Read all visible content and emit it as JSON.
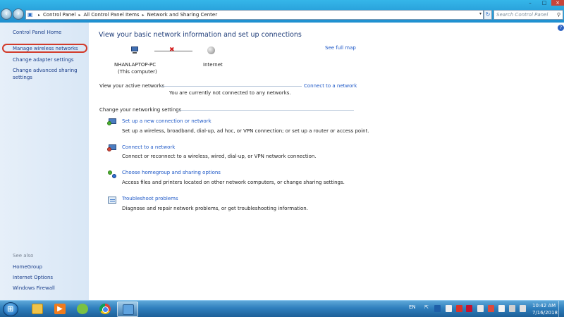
{
  "address": {
    "crumbs": [
      "Control Panel",
      "All Control Panel Items",
      "Network and Sharing Center"
    ],
    "separator": "▸",
    "search_placeholder": "Search Control Panel"
  },
  "window_controls": {
    "minimize": "–",
    "maximize": "□",
    "close": "×"
  },
  "sidebar": {
    "home": "Control Panel Home",
    "items": [
      {
        "label": "Manage wireless networks"
      },
      {
        "label": "Change adapter settings"
      },
      {
        "label": "Change advanced sharing"
      },
      {
        "label": "settings"
      }
    ],
    "see_also_heading": "See also",
    "see_also": [
      {
        "label": "HomeGroup"
      },
      {
        "label": "Internet Options"
      },
      {
        "label": "Windows Firewall"
      }
    ]
  },
  "main": {
    "title": "View your basic network information and set up connections",
    "see_full_map": "See full map",
    "computer_name": "NHANLAPTOP-PC",
    "computer_sub": "(This computer)",
    "internet_label": "Internet",
    "active_networks_label": "View your active networks",
    "connect_link": "Connect to a network",
    "not_connected": "You are currently not connected to any networks.",
    "change_settings_label": "Change your networking settings",
    "tasks": [
      {
        "title": "Set up a new connection or network",
        "desc": "Set up a wireless, broadband, dial-up, ad hoc, or VPN connection; or set up a router or access point."
      },
      {
        "title": "Connect to a network",
        "desc": "Connect or reconnect to a wireless, wired, dial-up, or VPN network connection."
      },
      {
        "title": "Choose homegroup and sharing options",
        "desc": "Access files and printers located on other network computers, or change sharing settings."
      },
      {
        "title": "Troubleshoot problems",
        "desc": "Diagnose and repair network problems, or get troubleshooting information."
      }
    ]
  },
  "taskbar": {
    "language": "EN",
    "time": "10:42 AM",
    "date": "7/16/2018"
  }
}
